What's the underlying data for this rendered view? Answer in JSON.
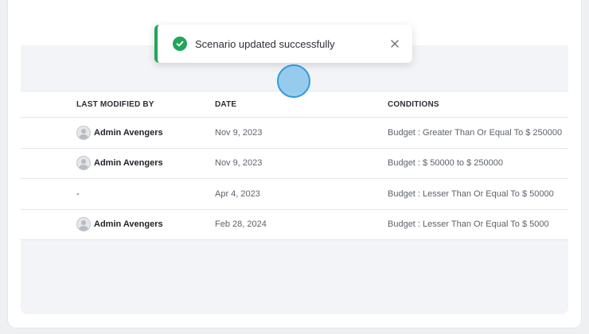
{
  "toast": {
    "message": "Scenario updated successfully",
    "status": "success",
    "accent_color": "#22a559",
    "icon": "check-circle-icon",
    "close_icon": "close-icon"
  },
  "table": {
    "headers": {
      "last_modified_by": "LAST MODIFIED BY",
      "date": "DATE",
      "conditions": "CONDITIONS"
    },
    "rows": [
      {
        "user": "Admin Avengers",
        "has_avatar": true,
        "date": "Nov 9, 2023",
        "conditions": "Budget : Greater Than Or Equal To $ 250000"
      },
      {
        "user": "Admin Avengers",
        "has_avatar": true,
        "date": "Nov 9, 2023",
        "conditions": "Budget : $ 50000 to $ 250000"
      },
      {
        "user": "-",
        "has_avatar": false,
        "date": "Apr 4, 2023",
        "conditions": "Budget : Lesser Than Or Equal To $ 50000"
      },
      {
        "user": "Admin Avengers",
        "has_avatar": true,
        "date": "Feb 28, 2024",
        "conditions": "Budget : Lesser Than Or Equal To $ 5000"
      }
    ]
  }
}
